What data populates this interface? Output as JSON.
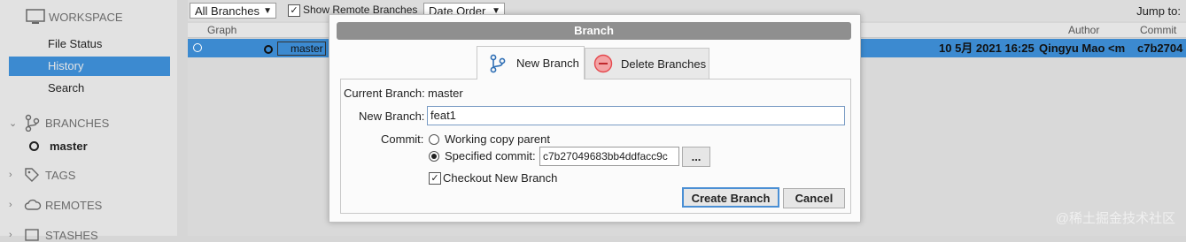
{
  "sidebar": {
    "workspace_label": "WORKSPACE",
    "items": [
      {
        "label": "File Status"
      },
      {
        "label": "History"
      },
      {
        "label": "Search"
      }
    ],
    "branches_label": "BRANCHES",
    "current_branch": "master",
    "tags_label": "TAGS",
    "remotes_label": "REMOTES",
    "stashes_label": "STASHES"
  },
  "toolbar": {
    "branches_filter": "All Branches",
    "show_remote_label": "Show Remote Branches",
    "order": "Date Order",
    "jump_to_label": "Jump to:"
  },
  "columns": {
    "graph": "Graph",
    "author": "Author",
    "commit": "Commit"
  },
  "row": {
    "branch_tag": "master",
    "date": "10 5月 2021 16:25",
    "author": "Qingyu Mao <m",
    "commit": "c7b2704"
  },
  "dialog": {
    "title": "Branch",
    "tab_new": "New Branch",
    "tab_delete": "Delete Branches",
    "current_branch_label": "Current Branch:",
    "current_branch_value": "master",
    "new_branch_label": "New Branch:",
    "new_branch_value": "feat1",
    "commit_label": "Commit:",
    "option_working": "Working copy parent",
    "option_specified": "Specified commit:",
    "specified_commit_value": "c7b27049683bb4ddfacc9c",
    "browse_button": "...",
    "checkout_label": "Checkout New Branch",
    "create_button": "Create Branch",
    "cancel_button": "Cancel"
  },
  "watermark": "@稀土掘金技术社区",
  "colors": {
    "selection": "#3c8ad0",
    "accent_blue": "#2f6fb5",
    "delete_red": "#e5484d"
  }
}
